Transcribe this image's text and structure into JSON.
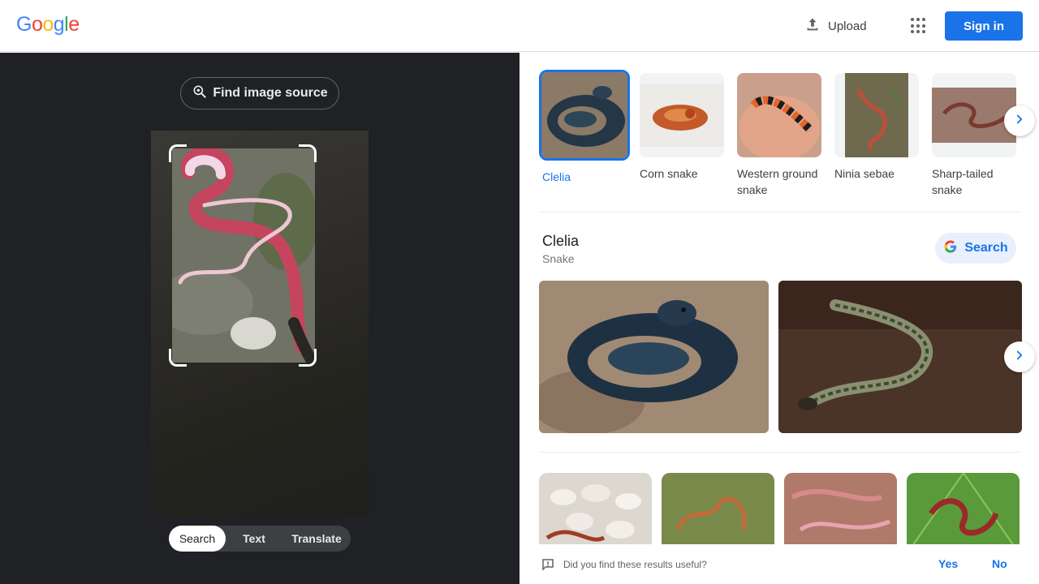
{
  "header": {
    "logo": [
      "G",
      "o",
      "o",
      "g",
      "l",
      "e"
    ],
    "logo_colors": [
      "#4285F4",
      "#EA4335",
      "#FBBC05",
      "#4285F4",
      "#34A853",
      "#EA4335"
    ],
    "upload_label": "Upload",
    "signin_label": "Sign in",
    "accent": "#1a73e8"
  },
  "left": {
    "find_source_label": "Find image source",
    "modes": [
      {
        "label": "Search",
        "active": true
      },
      {
        "label": "Text",
        "active": false
      },
      {
        "label": "Translate",
        "active": false
      }
    ]
  },
  "entities": [
    {
      "label": "Clelia",
      "selected": true
    },
    {
      "label": "Corn snake",
      "selected": false
    },
    {
      "label": "Western ground snake",
      "selected": false
    },
    {
      "label": "Ninia sebae",
      "selected": false
    },
    {
      "label": "Sharp-tailed snake",
      "selected": false
    }
  ],
  "knowledge": {
    "title": "Clelia",
    "subtitle": "Snake",
    "search_label": "Search"
  },
  "feedback": {
    "question": "Did you find these results useful?",
    "yes": "Yes",
    "no": "No"
  }
}
